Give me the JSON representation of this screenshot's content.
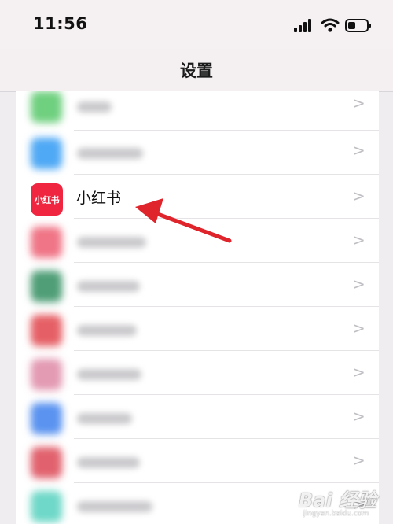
{
  "status_bar": {
    "time": "11:56",
    "icons": [
      "signal-icon",
      "wifi-icon",
      "battery-icon"
    ]
  },
  "nav": {
    "title": "设置"
  },
  "highlighted_app": {
    "name": "小红书",
    "logo_text": "小红书",
    "icon_color": "#f0253f"
  },
  "blurred_rows": [
    {
      "icon_color": "#6fd07f"
    },
    {
      "icon_color": "#4fa9f5"
    },
    {
      "icon_color": "#f07586"
    },
    {
      "icon_color": "#4f9e77"
    },
    {
      "icon_color": "#e56066"
    },
    {
      "icon_color": "#e39ab3"
    },
    {
      "icon_color": "#5a93f0"
    },
    {
      "icon_color": "#e1626e"
    },
    {
      "icon_color": "#6fd8c8"
    }
  ],
  "annotation": {
    "arrow_color": "#e0242c"
  },
  "watermark": {
    "logo": "Bai 经验",
    "url": "jingyan.baidu.com"
  }
}
